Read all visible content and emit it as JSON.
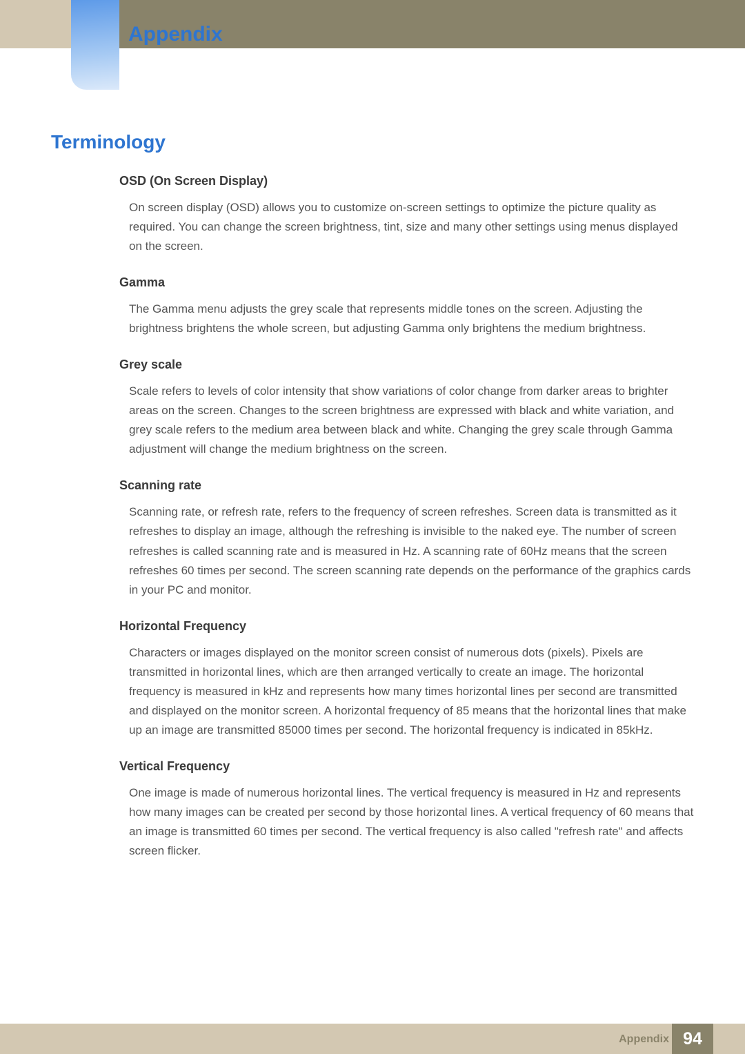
{
  "header": {
    "title": "Appendix"
  },
  "section": {
    "title": "Terminology"
  },
  "terms": [
    {
      "title": "OSD (On Screen Display)",
      "body": "On screen display (OSD) allows you to customize on-screen settings to optimize the picture quality as required. You can change the screen brightness, tint, size and many other settings using menus displayed on the screen."
    },
    {
      "title": "Gamma",
      "body": "The Gamma menu adjusts the grey scale that represents middle tones on the screen. Adjusting the brightness brightens the whole screen, but adjusting Gamma only brightens the medium brightness."
    },
    {
      "title": "Grey scale",
      "body": "Scale refers to levels of color intensity that show variations of color change from darker areas to brighter areas on the screen. Changes to the screen brightness are expressed with black and white variation, and grey scale refers to the medium area between black and white. Changing the grey scale through Gamma adjustment will change the medium brightness on the screen."
    },
    {
      "title": "Scanning rate",
      "body": "Scanning rate, or refresh rate, refers to the frequency of screen refreshes. Screen data is transmitted as it refreshes to display an image, although the refreshing is invisible to the naked eye. The number of screen refreshes is called scanning rate and is measured in Hz. A scanning rate of 60Hz means that the screen refreshes 60 times per second. The screen scanning rate depends on the performance of the graphics cards in your PC and monitor."
    },
    {
      "title": "Horizontal Frequency",
      "body": "Characters or images displayed on the monitor screen consist of numerous dots (pixels). Pixels are transmitted in horizontal lines, which are then arranged vertically to create an image. The horizontal frequency is measured in kHz and represents how many times horizontal lines per second are transmitted and displayed on the monitor screen. A horizontal frequency of 85 means that the horizontal lines that make up an image are transmitted 85000 times per second. The horizontal frequency is indicated in 85kHz."
    },
    {
      "title": "Vertical Frequency",
      "body": "One image is made of numerous horizontal lines. The vertical frequency is measured in Hz and represents how many images can be created per second by those horizontal lines. A vertical frequency of 60 means that an image is transmitted 60 times per second. The vertical frequency is also called \"refresh rate\" and affects screen flicker."
    }
  ],
  "footer": {
    "label": "Appendix",
    "page": "94"
  }
}
